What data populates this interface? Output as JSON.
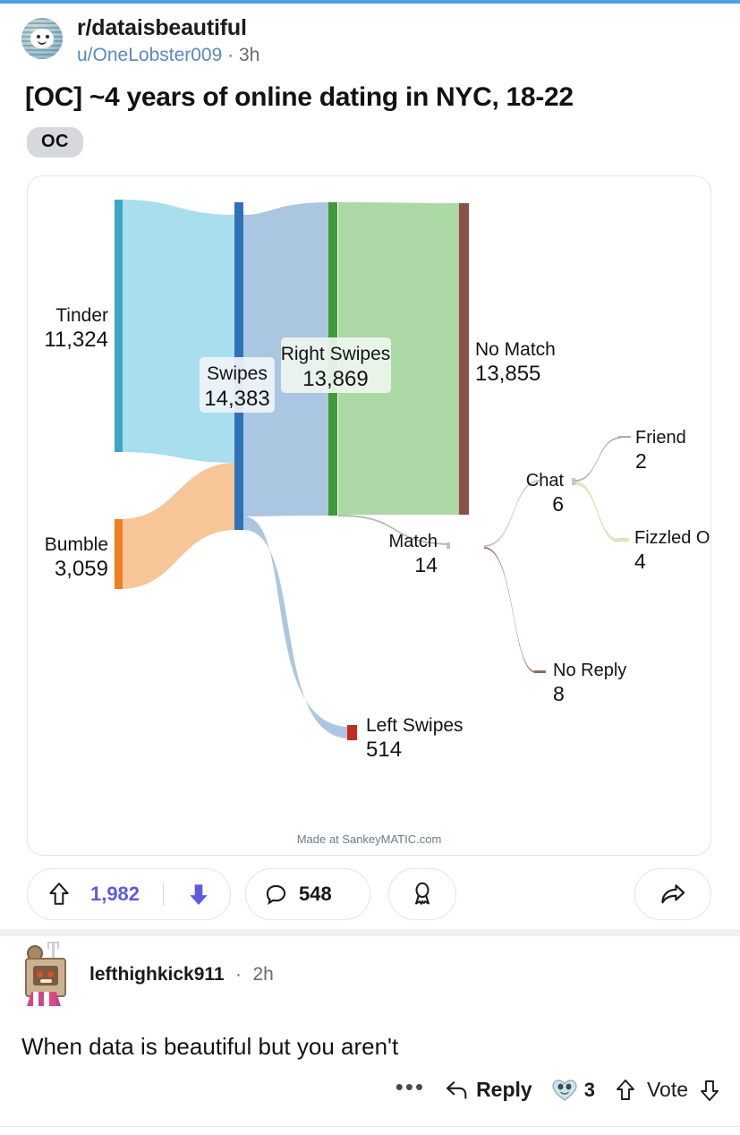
{
  "theme": {
    "accent_top": "#4aa3df",
    "upvote_purple": "#5d5ce0",
    "link_blue": "#5b87c4"
  },
  "post": {
    "subreddit": "r/dataisbeautiful",
    "author": "u/OneLobster009",
    "separator": "·",
    "age": "3h",
    "title": "[OC] ~4 years of online dating in NYC, 18-22",
    "flair": "OC",
    "avatar_icon": "subreddit-snoo-globe-icon"
  },
  "chart_data": {
    "type": "sankey",
    "title": "~4 years of online dating in NYC, 18-22",
    "credit": "Made at SankeyMATIC.com",
    "nodes": [
      {
        "id": "tinder",
        "label": "Tinder",
        "value": "11,324",
        "amount": 11324,
        "color": "#3ba7c4"
      },
      {
        "id": "bumble",
        "label": "Bumble",
        "value": "3,059",
        "amount": 3059,
        "color": "#ef7f1f"
      },
      {
        "id": "swipes",
        "label": "Swipes",
        "value": "14,383",
        "amount": 14383,
        "color": "#2f71b8"
      },
      {
        "id": "right_swipes",
        "label": "Right Swipes",
        "value": "13,869",
        "amount": 13869,
        "color": "#3f9b35"
      },
      {
        "id": "left_swipes",
        "label": "Left Swipes",
        "value": "514",
        "amount": 514,
        "color": "#c62b20"
      },
      {
        "id": "no_match",
        "label": "No Match",
        "value": "13,855",
        "amount": 13855,
        "color": "#8a5049"
      },
      {
        "id": "match",
        "label": "Match",
        "value": "14",
        "amount": 14,
        "color": "#b9c4b5"
      },
      {
        "id": "chat",
        "label": "Chat",
        "value": "6",
        "amount": 6,
        "color": "#c9c6bd"
      },
      {
        "id": "no_reply",
        "label": "No Reply",
        "value": "8",
        "amount": 8,
        "color": "#8a6a60"
      },
      {
        "id": "friend",
        "label": "Friend",
        "value": "2",
        "amount": 2,
        "color": "#b0a9a0"
      },
      {
        "id": "fizzled_out",
        "label": "Fizzled Out",
        "value": "4",
        "amount": 4,
        "color": "#e3e3bb"
      }
    ],
    "links": [
      {
        "source": "tinder",
        "target": "swipes",
        "value": 11324,
        "color": "#a3dced"
      },
      {
        "source": "bumble",
        "target": "swipes",
        "value": 3059,
        "color": "#f7c494"
      },
      {
        "source": "swipes",
        "target": "right_swipes",
        "value": 13869,
        "color": "#a6c3de"
      },
      {
        "source": "swipes",
        "target": "left_swipes",
        "value": 514,
        "color": "#a6c3de"
      },
      {
        "source": "right_swipes",
        "target": "no_match",
        "value": 13855,
        "color": "#a8d6a0"
      },
      {
        "source": "right_swipes",
        "target": "match",
        "value": 14,
        "color": "#b9c4b5"
      },
      {
        "source": "match",
        "target": "chat",
        "value": 6,
        "color": "#c9c6bd"
      },
      {
        "source": "match",
        "target": "no_reply",
        "value": 8,
        "color": "#8a6a60"
      },
      {
        "source": "chat",
        "target": "friend",
        "value": 2,
        "color": "#b0a9a0"
      },
      {
        "source": "chat",
        "target": "fizzled_out",
        "value": 4,
        "color": "#e3e3bb"
      }
    ]
  },
  "actions": {
    "vote_count": "1,982",
    "comment_count": "548",
    "upvote_icon": "upvote-arrow-icon",
    "downvote_icon": "downvote-arrow-icon",
    "comment_icon": "comment-bubble-icon",
    "award_icon": "award-ribbon-icon",
    "share_icon": "share-arrow-icon"
  },
  "comment": {
    "author": "lefthighkick911",
    "separator": "·",
    "age": "2h",
    "body": "When data is beautiful but you aren't",
    "avatar_icon": "cardboard-robot-avatar",
    "more_label": "•••",
    "reply_label": "Reply",
    "reaction_count": "3",
    "reaction_icon": "heart-eyes-emoji",
    "vote_label": "Vote"
  }
}
